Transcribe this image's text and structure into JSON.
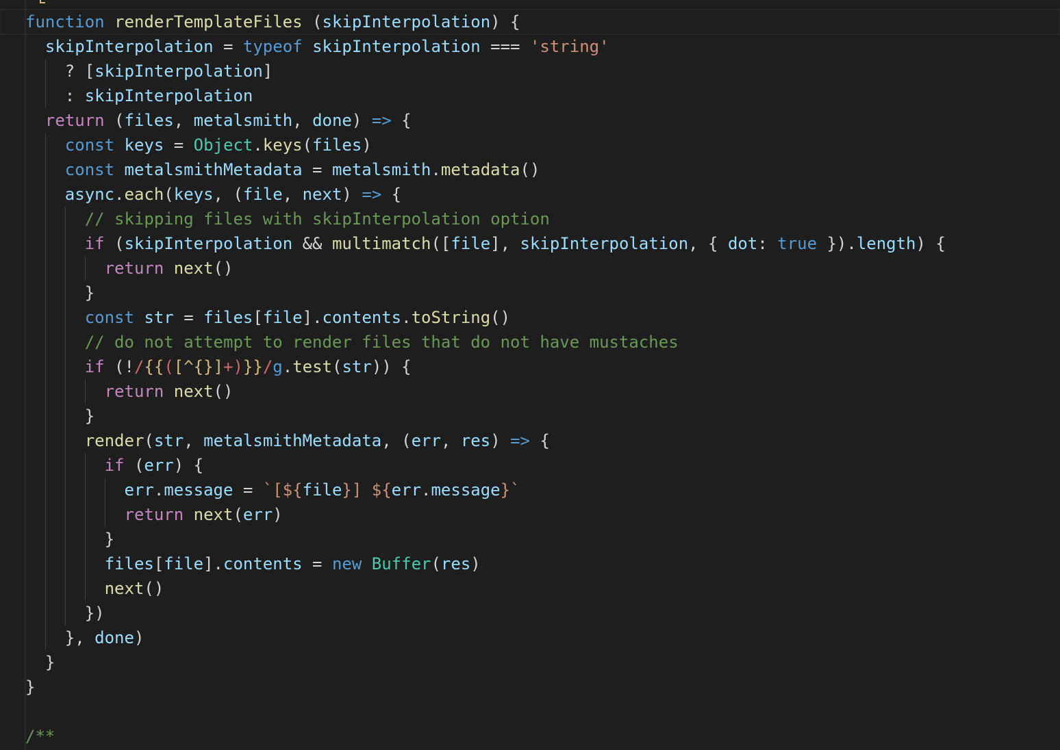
{
  "editor": {
    "theme": "dark",
    "colors": {
      "background": "#1e1e1e",
      "keyword": "#569cd6",
      "control": "#c586c0",
      "function": "#dcdcaa",
      "variable": "#9cdcfe",
      "string": "#ce9178",
      "comment": "#6a9955",
      "class": "#4ec9b0",
      "regex": "#d16969"
    },
    "lines": [
      [
        [
          "kw",
          "function"
        ],
        [
          "pun",
          " "
        ],
        [
          "fn",
          "renderTemplateFiles"
        ],
        [
          "pun",
          " ("
        ],
        [
          "var",
          "skipInterpolation"
        ],
        [
          "pun",
          ") {"
        ]
      ],
      [
        [
          "pun",
          "  "
        ],
        [
          "var",
          "skipInterpolation"
        ],
        [
          "pun",
          " = "
        ],
        [
          "kw",
          "typeof"
        ],
        [
          "pun",
          " "
        ],
        [
          "var",
          "skipInterpolation"
        ],
        [
          "pun",
          " === "
        ],
        [
          "str",
          "'string'"
        ]
      ],
      [
        [
          "pun",
          "    ? ["
        ],
        [
          "var",
          "skipInterpolation"
        ],
        [
          "pun",
          "]"
        ]
      ],
      [
        [
          "pun",
          "    : "
        ],
        [
          "var",
          "skipInterpolation"
        ]
      ],
      [
        [
          "pun",
          "  "
        ],
        [
          "kw2",
          "return"
        ],
        [
          "pun",
          " ("
        ],
        [
          "var",
          "files"
        ],
        [
          "pun",
          ", "
        ],
        [
          "var",
          "metalsmith"
        ],
        [
          "pun",
          ", "
        ],
        [
          "var",
          "done"
        ],
        [
          "pun",
          ") "
        ],
        [
          "kw",
          "=>"
        ],
        [
          "pun",
          " {"
        ]
      ],
      [
        [
          "pun",
          "    "
        ],
        [
          "kw",
          "const"
        ],
        [
          "pun",
          " "
        ],
        [
          "var",
          "keys"
        ],
        [
          "pun",
          " = "
        ],
        [
          "cls",
          "Object"
        ],
        [
          "pun",
          "."
        ],
        [
          "fn",
          "keys"
        ],
        [
          "pun",
          "("
        ],
        [
          "var",
          "files"
        ],
        [
          "pun",
          ")"
        ]
      ],
      [
        [
          "pun",
          "    "
        ],
        [
          "kw",
          "const"
        ],
        [
          "pun",
          " "
        ],
        [
          "var",
          "metalsmithMetadata"
        ],
        [
          "pun",
          " = "
        ],
        [
          "var",
          "metalsmith"
        ],
        [
          "pun",
          "."
        ],
        [
          "fn",
          "metadata"
        ],
        [
          "pun",
          "()"
        ]
      ],
      [
        [
          "pun",
          "    "
        ],
        [
          "var",
          "async"
        ],
        [
          "pun",
          "."
        ],
        [
          "fn",
          "each"
        ],
        [
          "pun",
          "("
        ],
        [
          "var",
          "keys"
        ],
        [
          "pun",
          ", ("
        ],
        [
          "var",
          "file"
        ],
        [
          "pun",
          ", "
        ],
        [
          "var",
          "next"
        ],
        [
          "pun",
          ") "
        ],
        [
          "kw",
          "=>"
        ],
        [
          "pun",
          " {"
        ]
      ],
      [
        [
          "pun",
          "      "
        ],
        [
          "com",
          "// skipping files with skipInterpolation option"
        ]
      ],
      [
        [
          "pun",
          "      "
        ],
        [
          "kw2",
          "if"
        ],
        [
          "pun",
          " ("
        ],
        [
          "var",
          "skipInterpolation"
        ],
        [
          "pun",
          " && "
        ],
        [
          "fn",
          "multimatch"
        ],
        [
          "pun",
          "(["
        ],
        [
          "var",
          "file"
        ],
        [
          "pun",
          "], "
        ],
        [
          "var",
          "skipInterpolation"
        ],
        [
          "pun",
          ", { "
        ],
        [
          "var",
          "dot"
        ],
        [
          "pun",
          ": "
        ],
        [
          "kw",
          "true"
        ],
        [
          "pun",
          " })."
        ],
        [
          "var",
          "length"
        ],
        [
          "pun",
          ") {"
        ]
      ],
      [
        [
          "pun",
          "        "
        ],
        [
          "kw2",
          "return"
        ],
        [
          "pun",
          " "
        ],
        [
          "fn",
          "next"
        ],
        [
          "pun",
          "()"
        ]
      ],
      [
        [
          "pun",
          "      }"
        ]
      ],
      [
        [
          "pun",
          "      "
        ],
        [
          "kw",
          "const"
        ],
        [
          "pun",
          " "
        ],
        [
          "var",
          "str"
        ],
        [
          "pun",
          " = "
        ],
        [
          "var",
          "files"
        ],
        [
          "pun",
          "["
        ],
        [
          "var",
          "file"
        ],
        [
          "pun",
          "]."
        ],
        [
          "var",
          "contents"
        ],
        [
          "pun",
          "."
        ],
        [
          "fn",
          "toString"
        ],
        [
          "pun",
          "()"
        ]
      ],
      [
        [
          "pun",
          "      "
        ],
        [
          "com",
          "// do not attempt to render files that do not have mustaches"
        ]
      ],
      [
        [
          "pun",
          "      "
        ],
        [
          "kw2",
          "if"
        ],
        [
          "pun",
          " (!"
        ],
        [
          "rx",
          "/"
        ],
        [
          "rxq",
          "{{"
        ],
        [
          "rx",
          "("
        ],
        [
          "rxq",
          "[^{}]"
        ],
        [
          "rx",
          "+"
        ],
        [
          "rx",
          ")"
        ],
        [
          "rxq",
          "}}"
        ],
        [
          "rx",
          "/"
        ],
        [
          "kw",
          "g"
        ],
        [
          "pun",
          "."
        ],
        [
          "fn",
          "test"
        ],
        [
          "pun",
          "("
        ],
        [
          "var",
          "str"
        ],
        [
          "pun",
          ")) {"
        ]
      ],
      [
        [
          "pun",
          "        "
        ],
        [
          "kw2",
          "return"
        ],
        [
          "pun",
          " "
        ],
        [
          "fn",
          "next"
        ],
        [
          "pun",
          "()"
        ]
      ],
      [
        [
          "pun",
          "      }"
        ]
      ],
      [
        [
          "pun",
          "      "
        ],
        [
          "fn",
          "render"
        ],
        [
          "pun",
          "("
        ],
        [
          "var",
          "str"
        ],
        [
          "pun",
          ", "
        ],
        [
          "var",
          "metalsmithMetadata"
        ],
        [
          "pun",
          ", ("
        ],
        [
          "var",
          "err"
        ],
        [
          "pun",
          ", "
        ],
        [
          "var",
          "res"
        ],
        [
          "pun",
          ") "
        ],
        [
          "kw",
          "=>"
        ],
        [
          "pun",
          " {"
        ]
      ],
      [
        [
          "pun",
          "        "
        ],
        [
          "kw2",
          "if"
        ],
        [
          "pun",
          " ("
        ],
        [
          "var",
          "err"
        ],
        [
          "pun",
          ") {"
        ]
      ],
      [
        [
          "pun",
          "          "
        ],
        [
          "var",
          "err"
        ],
        [
          "pun",
          "."
        ],
        [
          "var",
          "message"
        ],
        [
          "pun",
          " = "
        ],
        [
          "str",
          "`[${"
        ],
        [
          "var",
          "file"
        ],
        [
          "str",
          "}] ${"
        ],
        [
          "var",
          "err"
        ],
        [
          "pun",
          "."
        ],
        [
          "var",
          "message"
        ],
        [
          "str",
          "}`"
        ]
      ],
      [
        [
          "pun",
          "          "
        ],
        [
          "kw2",
          "return"
        ],
        [
          "pun",
          " "
        ],
        [
          "fn",
          "next"
        ],
        [
          "pun",
          "("
        ],
        [
          "var",
          "err"
        ],
        [
          "pun",
          ")"
        ]
      ],
      [
        [
          "pun",
          "        }"
        ]
      ],
      [
        [
          "pun",
          "        "
        ],
        [
          "var",
          "files"
        ],
        [
          "pun",
          "["
        ],
        [
          "var",
          "file"
        ],
        [
          "pun",
          "]."
        ],
        [
          "var",
          "contents"
        ],
        [
          "pun",
          " = "
        ],
        [
          "kw",
          "new"
        ],
        [
          "pun",
          " "
        ],
        [
          "cls",
          "Buffer"
        ],
        [
          "pun",
          "("
        ],
        [
          "var",
          "res"
        ],
        [
          "pun",
          ")"
        ]
      ],
      [
        [
          "pun",
          "        "
        ],
        [
          "fn",
          "next"
        ],
        [
          "pun",
          "()"
        ]
      ],
      [
        [
          "pun",
          "      })"
        ]
      ],
      [
        [
          "pun",
          "    }, "
        ],
        [
          "var",
          "done"
        ],
        [
          "pun",
          ")"
        ]
      ],
      [
        [
          "pun",
          "  }"
        ]
      ],
      [
        [
          "pun",
          "}"
        ]
      ],
      [
        [
          "pun",
          ""
        ]
      ],
      [
        [
          "com",
          "/**"
        ]
      ]
    ]
  }
}
